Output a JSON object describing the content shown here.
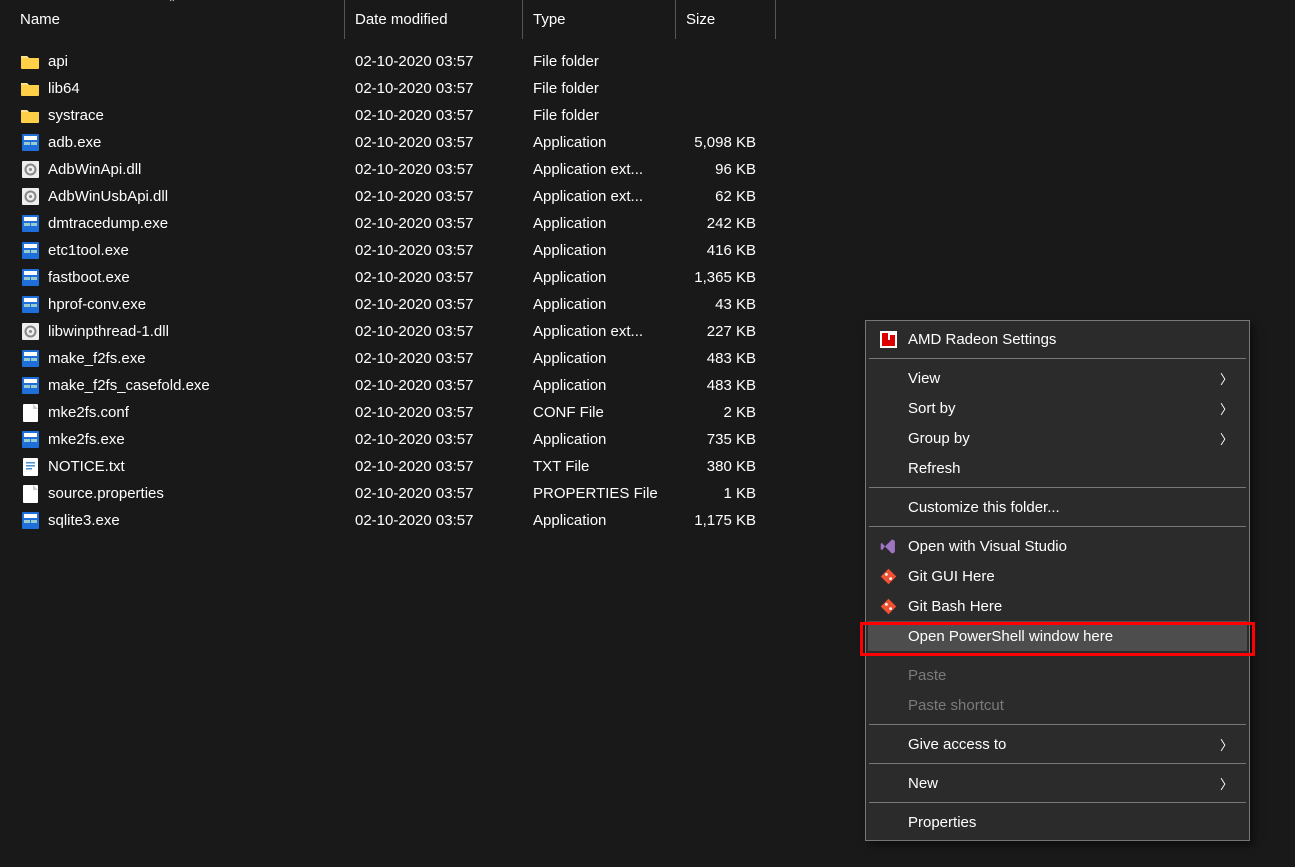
{
  "columns": {
    "name": "Name",
    "date": "Date modified",
    "type": "Type",
    "size": "Size"
  },
  "files": [
    {
      "icon": "folder",
      "name": "api",
      "date": "02-10-2020 03:57",
      "type": "File folder",
      "size": ""
    },
    {
      "icon": "folder",
      "name": "lib64",
      "date": "02-10-2020 03:57",
      "type": "File folder",
      "size": ""
    },
    {
      "icon": "folder",
      "name": "systrace",
      "date": "02-10-2020 03:57",
      "type": "File folder",
      "size": ""
    },
    {
      "icon": "exe",
      "name": "adb.exe",
      "date": "02-10-2020 03:57",
      "type": "Application",
      "size": "5,098 KB"
    },
    {
      "icon": "dll",
      "name": "AdbWinApi.dll",
      "date": "02-10-2020 03:57",
      "type": "Application ext...",
      "size": "96 KB"
    },
    {
      "icon": "dll",
      "name": "AdbWinUsbApi.dll",
      "date": "02-10-2020 03:57",
      "type": "Application ext...",
      "size": "62 KB"
    },
    {
      "icon": "exe",
      "name": "dmtracedump.exe",
      "date": "02-10-2020 03:57",
      "type": "Application",
      "size": "242 KB"
    },
    {
      "icon": "exe",
      "name": "etc1tool.exe",
      "date": "02-10-2020 03:57",
      "type": "Application",
      "size": "416 KB"
    },
    {
      "icon": "exe",
      "name": "fastboot.exe",
      "date": "02-10-2020 03:57",
      "type": "Application",
      "size": "1,365 KB"
    },
    {
      "icon": "exe",
      "name": "hprof-conv.exe",
      "date": "02-10-2020 03:57",
      "type": "Application",
      "size": "43 KB"
    },
    {
      "icon": "dll",
      "name": "libwinpthread-1.dll",
      "date": "02-10-2020 03:57",
      "type": "Application ext...",
      "size": "227 KB"
    },
    {
      "icon": "exe",
      "name": "make_f2fs.exe",
      "date": "02-10-2020 03:57",
      "type": "Application",
      "size": "483 KB"
    },
    {
      "icon": "exe",
      "name": "make_f2fs_casefold.exe",
      "date": "02-10-2020 03:57",
      "type": "Application",
      "size": "483 KB"
    },
    {
      "icon": "file",
      "name": "mke2fs.conf",
      "date": "02-10-2020 03:57",
      "type": "CONF File",
      "size": "2 KB"
    },
    {
      "icon": "exe",
      "name": "mke2fs.exe",
      "date": "02-10-2020 03:57",
      "type": "Application",
      "size": "735 KB"
    },
    {
      "icon": "txt",
      "name": "NOTICE.txt",
      "date": "02-10-2020 03:57",
      "type": "TXT File",
      "size": "380 KB"
    },
    {
      "icon": "file",
      "name": "source.properties",
      "date": "02-10-2020 03:57",
      "type": "PROPERTIES File",
      "size": "1 KB"
    },
    {
      "icon": "exe",
      "name": "sqlite3.exe",
      "date": "02-10-2020 03:57",
      "type": "Application",
      "size": "1,175 KB"
    }
  ],
  "menu": {
    "amd": "AMD Radeon Settings",
    "view": "View",
    "sortby": "Sort by",
    "groupby": "Group by",
    "refresh": "Refresh",
    "customize": "Customize this folder...",
    "vs": "Open with Visual Studio",
    "gitgui": "Git GUI Here",
    "gitbash": "Git Bash Here",
    "powershell": "Open PowerShell window here",
    "paste": "Paste",
    "pasteshortcut": "Paste shortcut",
    "giveaccess": "Give access to",
    "new": "New",
    "properties": "Properties"
  }
}
